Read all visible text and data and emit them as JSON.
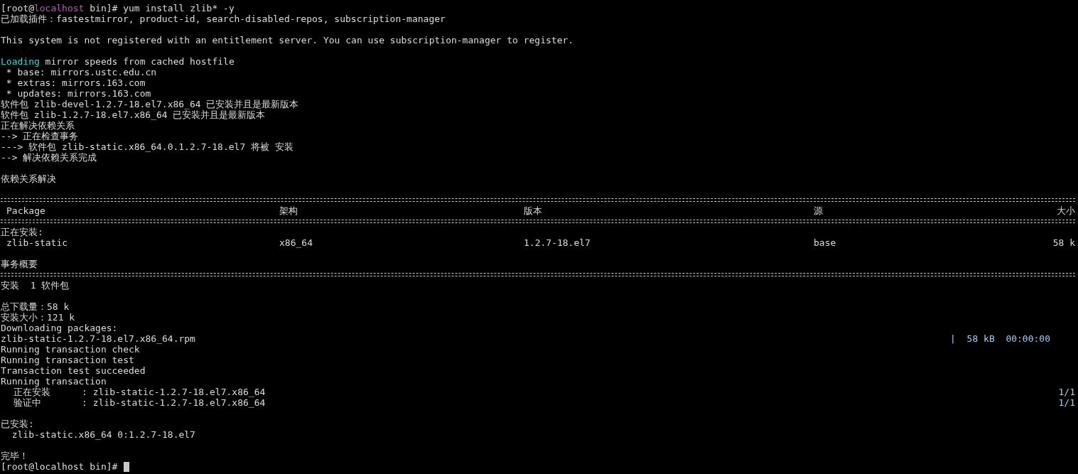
{
  "terminal": {
    "lines": [
      {
        "kind": "prompt",
        "segments": [
          {
            "text": "[root@"
          },
          {
            "text": "localhost",
            "color": "#c74fc7"
          },
          {
            "text": " bin]# yum install zlib* -y"
          }
        ]
      },
      {
        "kind": "text",
        "text": "已加载插件：fastestmirror, product-id, search-disabled-repos, subscription-manager"
      },
      {
        "kind": "blank"
      },
      {
        "kind": "text",
        "text": "This system is not registered with an entitlement server. You can use subscription-manager to register."
      },
      {
        "kind": "blank"
      },
      {
        "kind": "segments",
        "segments": [
          {
            "text": "Loading",
            "color": "#3fd3d3"
          },
          {
            "text": " mirror speeds from cached hostfile"
          }
        ]
      },
      {
        "kind": "text",
        "text": " * base: mirrors.ustc.edu.cn"
      },
      {
        "kind": "text",
        "text": " * extras: mirrors.163.com"
      },
      {
        "kind": "text",
        "text": " * updates: mirrors.163.com"
      },
      {
        "kind": "text",
        "text": "软件包 zlib-devel-1.2.7-18.el7.x86_64 已安装并且是最新版本"
      },
      {
        "kind": "text",
        "text": "软件包 zlib-1.2.7-18.el7.x86_64 已安装并且是最新版本"
      },
      {
        "kind": "text",
        "text": "正在解决依赖关系"
      },
      {
        "kind": "text",
        "text": "--> 正在检查事务"
      },
      {
        "kind": "text",
        "text": "---> 软件包 zlib-static.x86_64.0.1.2.7-18.el7 将被 安装"
      },
      {
        "kind": "text",
        "text": "--> 解决依赖关系完成"
      },
      {
        "kind": "blank"
      },
      {
        "kind": "text",
        "text": "依赖关系解决"
      },
      {
        "kind": "blank"
      },
      {
        "kind": "rule"
      },
      {
        "kind": "table_header",
        "cells": [
          "Package",
          "架构",
          "版本",
          "源",
          "大小"
        ]
      },
      {
        "kind": "rule"
      },
      {
        "kind": "text",
        "text": "正在安装:"
      },
      {
        "kind": "table_row",
        "cells": [
          "zlib-static",
          "x86_64",
          "1.2.7-18.el7",
          "base",
          "58 k"
        ]
      },
      {
        "kind": "blank"
      },
      {
        "kind": "text",
        "text": "事务概要"
      },
      {
        "kind": "rule"
      },
      {
        "kind": "text",
        "text": "安装  1 软件包"
      },
      {
        "kind": "blank"
      },
      {
        "kind": "text",
        "text": "总下载量：58 k"
      },
      {
        "kind": "text",
        "text": "安装大小：121 k"
      },
      {
        "kind": "text",
        "text": "Downloading packages:"
      },
      {
        "kind": "progress",
        "text": "zlib-static-1.2.7-18.el7.x86_64.rpm",
        "status": "|  58 kB  00:00:00"
      },
      {
        "kind": "text",
        "text": "Running transaction check"
      },
      {
        "kind": "text",
        "text": "Running transaction test"
      },
      {
        "kind": "text",
        "text": "Transaction test succeeded"
      },
      {
        "kind": "text",
        "text": "Running transaction"
      },
      {
        "kind": "step",
        "label": "正在安装",
        "detail": ": zlib-static-1.2.7-18.el7.x86_64",
        "count": "1/1"
      },
      {
        "kind": "step",
        "label": "验证中",
        "detail": ": zlib-static-1.2.7-18.el7.x86_64",
        "count": "1/1"
      },
      {
        "kind": "blank"
      },
      {
        "kind": "text",
        "text": "已安装:"
      },
      {
        "kind": "text",
        "text": "  zlib-static.x86_64 0:1.2.7-18.el7"
      },
      {
        "kind": "blank"
      },
      {
        "kind": "text",
        "text": "完毕！"
      },
      {
        "kind": "prompt",
        "segments": [
          {
            "text": "[root@localhost bin]# "
          }
        ],
        "cursor": true
      }
    ]
  }
}
